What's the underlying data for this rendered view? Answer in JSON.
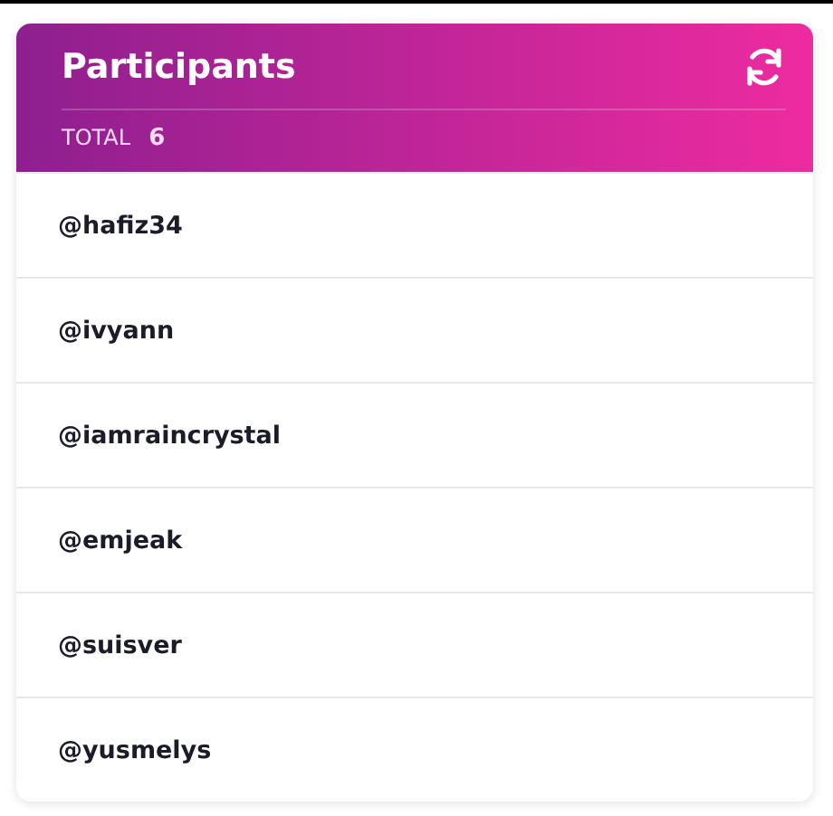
{
  "header": {
    "title": "Participants",
    "total_label": "TOTAL",
    "total_count": "6"
  },
  "participants": [
    {
      "handle": "@hafiz34"
    },
    {
      "handle": "@ivyann"
    },
    {
      "handle": "@iamraincrystal"
    },
    {
      "handle": "@emjeak"
    },
    {
      "handle": "@suisver"
    },
    {
      "handle": "@yusmelys"
    }
  ]
}
